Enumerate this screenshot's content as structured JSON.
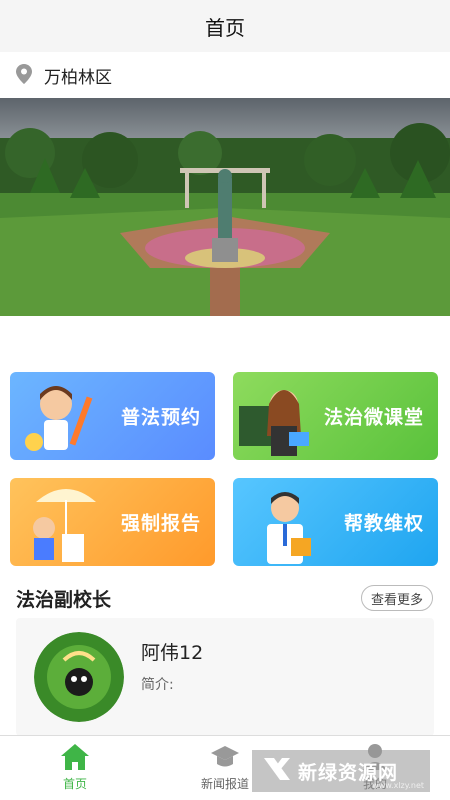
{
  "header": {
    "title": "首页"
  },
  "location": {
    "icon": "map-pin-icon",
    "text": "万柏林区"
  },
  "banner": {
    "alt": "garden-banner"
  },
  "tiles": [
    {
      "label": "普法预约",
      "icon": "student-with-pencil",
      "color": "#5a8cff"
    },
    {
      "label": "法治微课堂",
      "icon": "teacher-at-blackboard",
      "color": "#5ac23c"
    },
    {
      "label": "强制报告",
      "icon": "child-with-umbrella",
      "color": "#ff9a2b"
    },
    {
      "label": "帮教维权",
      "icon": "doctor-with-clipboard",
      "color": "#1fa5f0"
    }
  ],
  "section": {
    "title": "法治副校长",
    "more": "查看更多"
  },
  "card": {
    "name": "阿伟12",
    "intro": "简介:"
  },
  "tabbar": [
    {
      "label": "首页",
      "icon": "home-icon",
      "active": true
    },
    {
      "label": "新闻报道",
      "icon": "graduation-cap-icon",
      "active": false
    },
    {
      "label": "我的",
      "icon": "user-icon",
      "active": false
    }
  ],
  "watermark": {
    "text": "新绿资源网",
    "sub": "www.xlzy.net"
  },
  "colors": {
    "accent": "#3fb547",
    "header_bg": "#f5f5f5"
  }
}
